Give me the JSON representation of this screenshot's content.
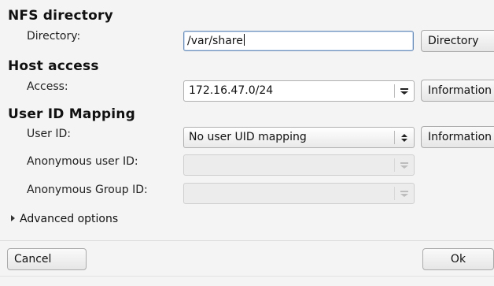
{
  "nfs": {
    "title": "NFS directory",
    "directory_label": "Directory:",
    "directory_value": "/var/share",
    "directory_button": "Directory"
  },
  "host": {
    "title": "Host access",
    "access_label": "Access:",
    "access_value": "172.16.47.0/24",
    "info_button": "Information"
  },
  "uid": {
    "title": "User ID Mapping",
    "userid_label": "User ID:",
    "userid_value": "No user UID mapping",
    "info_button": "Information",
    "anon_user_label": "Anonymous user ID:",
    "anon_user_value": "",
    "anon_group_label": "Anonymous Group ID:",
    "anon_group_value": ""
  },
  "advanced_label": "Advanced options",
  "footer": {
    "cancel_label": "Cancel",
    "ok_label": "Ok"
  }
}
